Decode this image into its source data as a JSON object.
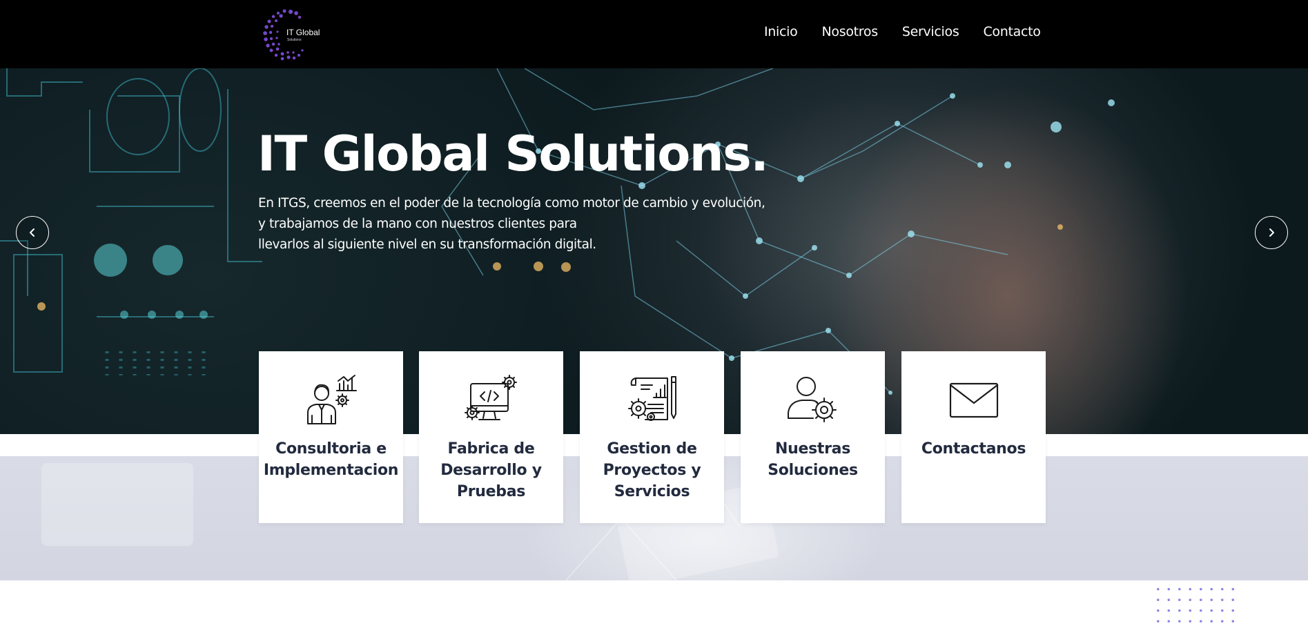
{
  "header": {
    "logo_text": "IT Global",
    "logo_subtext": "Solutions",
    "nav": [
      {
        "label": "Inicio"
      },
      {
        "label": "Nosotros"
      },
      {
        "label": "Servicios"
      },
      {
        "label": "Contacto"
      }
    ]
  },
  "hero": {
    "title": "IT Global Solutions.",
    "text_lines": [
      "En ITGS, creemos en el poder de la tecnología como motor de cambio y evolución,",
      "y trabajamos de la mano con nuestros clientes para",
      "llevarlos al siguiente nivel en su transformación digital."
    ],
    "prev_icon": "chevron-left-icon",
    "next_icon": "chevron-right-icon"
  },
  "cards": [
    {
      "icon": "consultant-chart-icon",
      "title_lines": [
        "Consultoria e",
        "Implementacion"
      ]
    },
    {
      "icon": "monitor-code-gears-icon",
      "title_lines": [
        "Fabrica de",
        "Desarrollo y",
        "Pruebas"
      ]
    },
    {
      "icon": "document-gears-icon",
      "title_lines": [
        "Gestion de",
        "Proyectos y",
        "Servicios"
      ]
    },
    {
      "icon": "user-gear-icon",
      "title_lines": [
        "Nuestras",
        "Soluciones"
      ]
    },
    {
      "icon": "envelope-icon",
      "title_lines": [
        "Contactanos"
      ]
    }
  ],
  "colors": {
    "header_bg": "#000000",
    "card_title": "#222a3e",
    "dots_accent": "#8b87e6",
    "band_gray": "#d9dce6"
  }
}
